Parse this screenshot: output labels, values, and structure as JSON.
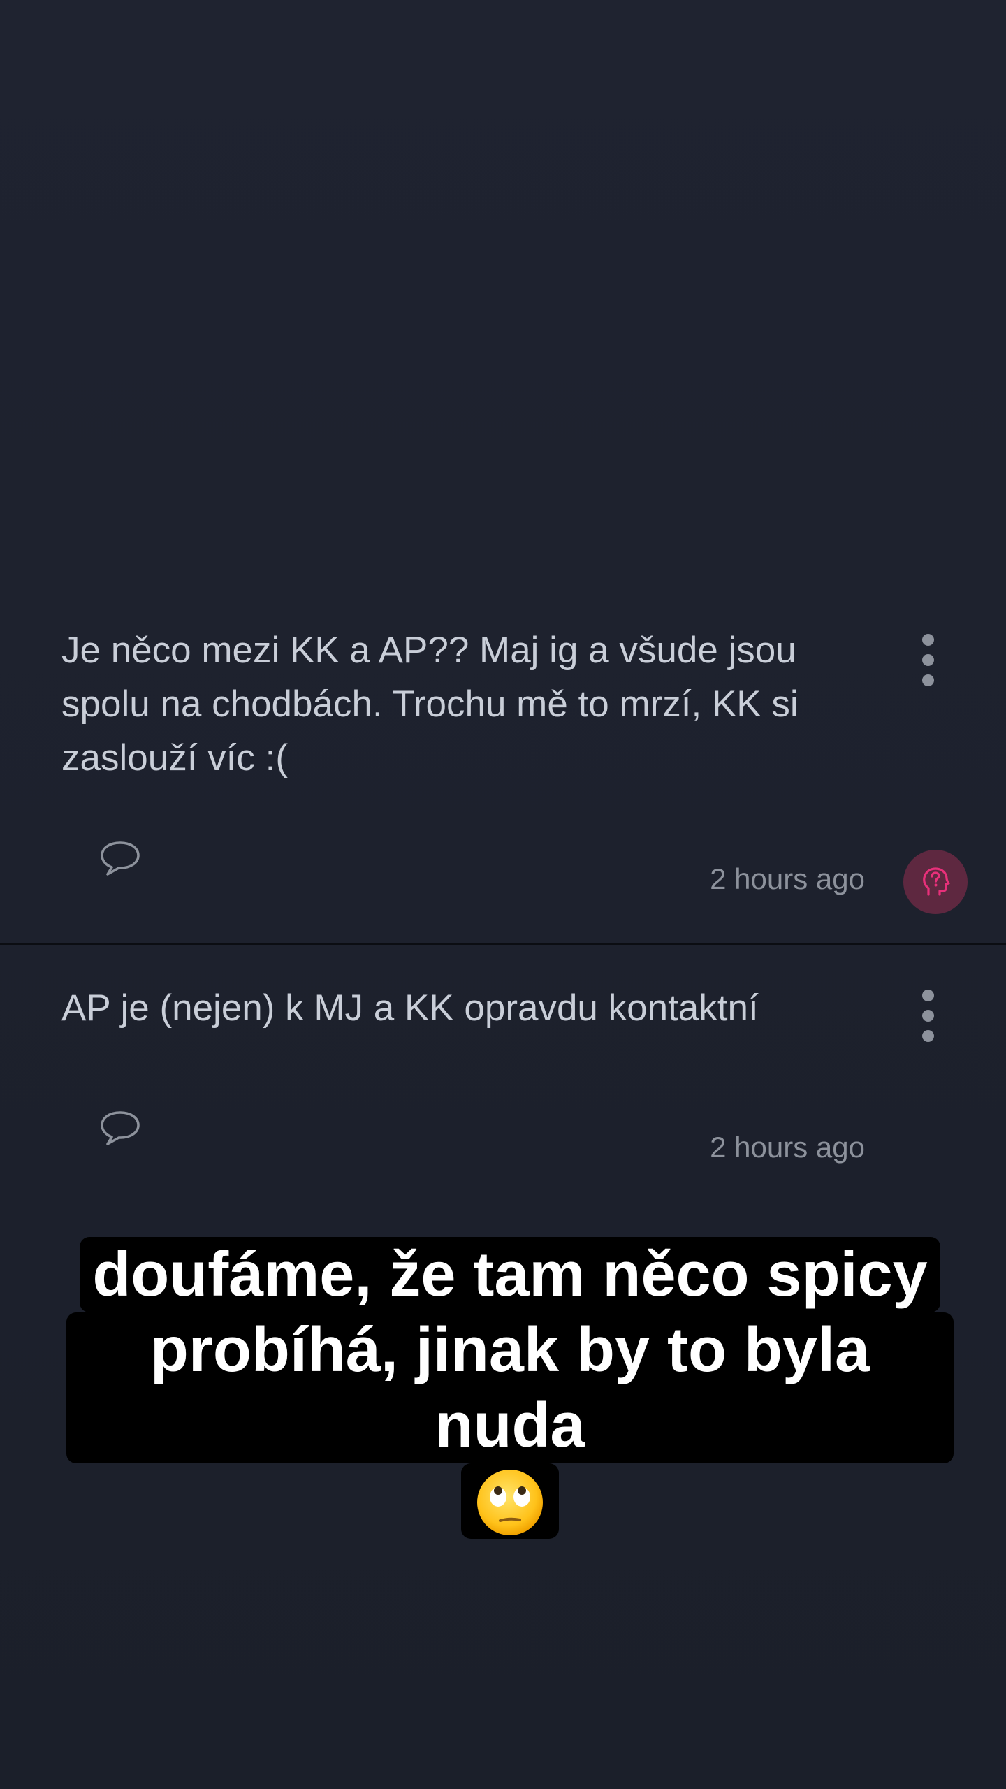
{
  "posts": [
    {
      "text": "Je něco mezi KK a AP?? Maj ig a všude jsou spolu na chodbách. Trochu mě to mrzí, KK si zaslouží víc :(",
      "timestamp": "2 hours ago",
      "icons": [
        "more-vertical-icon",
        "comment-icon",
        "question-head-icon"
      ]
    },
    {
      "text": "AP je (nejen) k MJ a KK opravdu kontaktní",
      "timestamp": "2 hours ago",
      "icons": [
        "more-vertical-icon",
        "comment-icon"
      ]
    }
  ],
  "overlay": {
    "caption_line1": "doufáme, že tam něco spicy",
    "caption_line2": "probíhá, jinak by to byla nuda",
    "caption_emoji": "face-with-rolling-eyes"
  },
  "colors": {
    "background": "#1e222d",
    "text": "#c9ced8",
    "muted": "#8d929c",
    "accent_pink": "#e8307a",
    "ask_bg": "#5e2840",
    "caption_bg": "#000000",
    "caption_text": "#ffffff"
  }
}
